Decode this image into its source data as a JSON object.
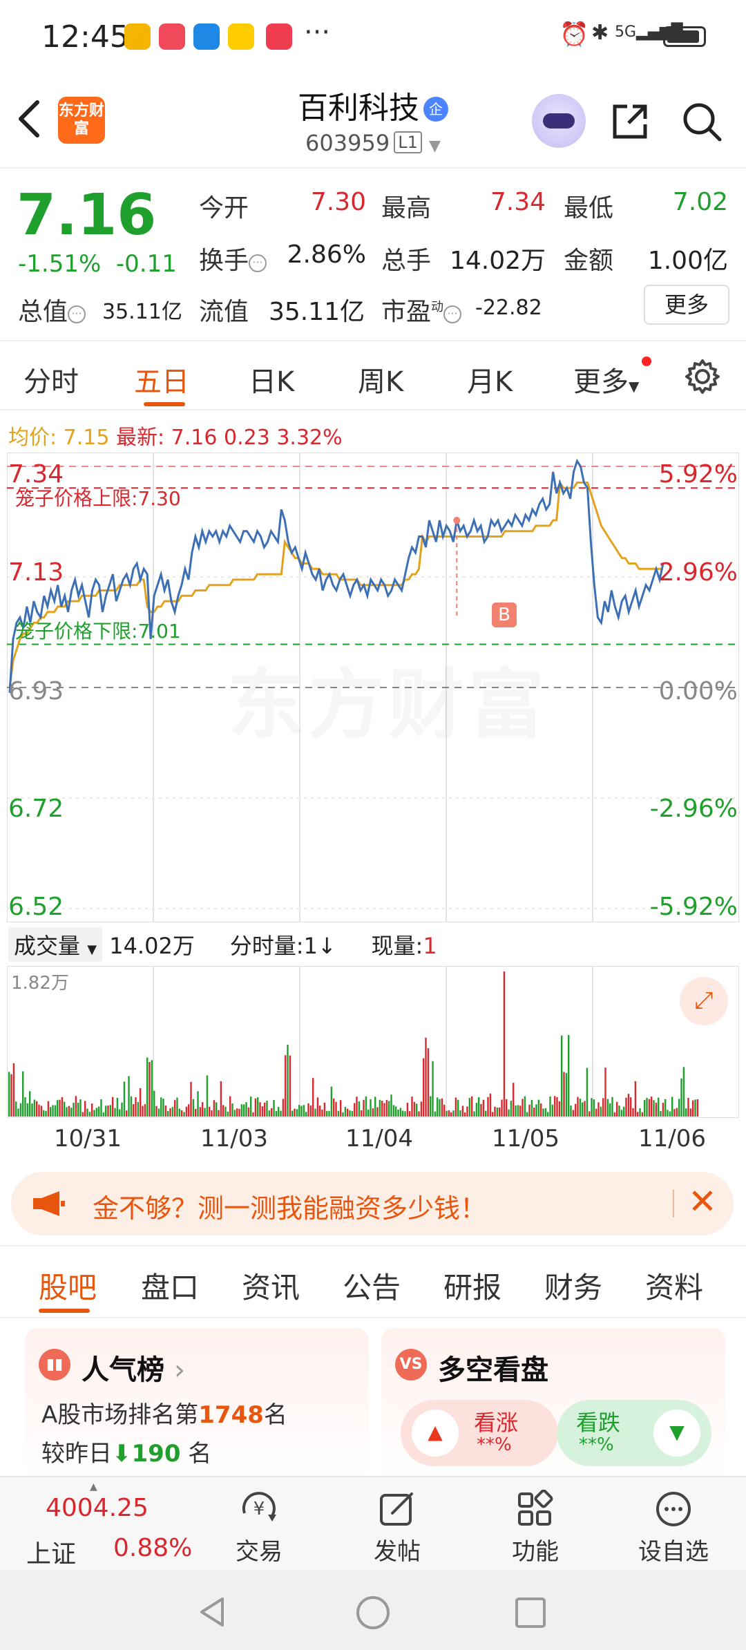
{
  "status_bar": {
    "time": "12:45",
    "more": "···",
    "icons": [
      "bluetooth-icon",
      "alarm-icon",
      "signal-icon",
      "battery-icon"
    ],
    "net": "5G"
  },
  "header": {
    "brand_logo_text": "东方财富",
    "stock_name": "百利科技",
    "badge": "企",
    "stock_code": "603959",
    "level": "L1"
  },
  "quote": {
    "price": "7.16",
    "change_pct": "-1.51%",
    "change_abs": "-0.11",
    "open_label": "今开",
    "open": "7.30",
    "high_label": "最高",
    "high": "7.34",
    "low_label": "最低",
    "low": "7.02",
    "turnover_label": "换手",
    "turnover": "2.86%",
    "volume_label": "总手",
    "volume": "14.02万",
    "amount_label": "金额",
    "amount": "1.00亿",
    "mktcap_label": "总值",
    "mktcap": "35.11亿",
    "float_label": "流值",
    "float_cap": "35.11亿",
    "pe_label": "市盈",
    "pe_sup": "动",
    "pe": "-22.82",
    "more_button": "更多"
  },
  "period_tabs": [
    "分时",
    "五日",
    "日K",
    "周K",
    "月K",
    "更多"
  ],
  "active_period": "五日",
  "legend": {
    "avg_label": "均价:",
    "avg_value": "7.15",
    "last_label": "最新:",
    "last_value": "7.16",
    "last_change": "0.23",
    "last_pct": "3.32%"
  },
  "chart_data": {
    "type": "line",
    "y_left_ticks": [
      "7.34",
      "7.13",
      "6.93",
      "6.72",
      "6.52"
    ],
    "y_right_ticks": [
      "5.92%",
      "2.96%",
      "0.00%",
      "-2.96%",
      "-5.92%"
    ],
    "ylim": [
      6.52,
      7.34
    ],
    "upper_limit_label": "笼子价格上限:",
    "upper_limit": 7.3,
    "upper_limit_text": "7.30",
    "lower_limit_label": "笼子价格下限:",
    "lower_limit": 7.01,
    "lower_limit_text": "7.01",
    "marker_label": "B",
    "dates": [
      "10/31",
      "11/03",
      "11/04",
      "11/05",
      "11/06"
    ],
    "series": [
      {
        "name": "price",
        "values": [
          6.92,
          7.02,
          7.05,
          7.06,
          7.04,
          7.08,
          7.05,
          7.09,
          7.07,
          7.06,
          7.1,
          7.08,
          7.11,
          7.09,
          7.12,
          7.08,
          7.1,
          7.07,
          7.11,
          7.13,
          7.1,
          7.12,
          7.09,
          7.06,
          7.11,
          7.13,
          7.12,
          7.07,
          7.1,
          7.12,
          7.14,
          7.09,
          7.11,
          7.13,
          7.14,
          7.12,
          7.15,
          7.16,
          7.13,
          7.15,
          7.14,
          7.02,
          7.1,
          7.12,
          7.14,
          7.11,
          7.13,
          7.09,
          7.07,
          7.1,
          7.12,
          7.15,
          7.13,
          7.18,
          7.21,
          7.19,
          7.22,
          7.2,
          7.22,
          7.21,
          7.22,
          7.2,
          7.22,
          7.21,
          7.23,
          7.22,
          7.21,
          7.2,
          7.22,
          7.22,
          7.21,
          7.2,
          7.22,
          7.21,
          7.19,
          7.2,
          7.22,
          7.21,
          7.2,
          7.26,
          7.24,
          7.2,
          7.18,
          7.19,
          7.17,
          7.15,
          7.18,
          7.16,
          7.14,
          7.13,
          7.15,
          7.11,
          7.13,
          7.14,
          7.12,
          7.11,
          7.13,
          7.14,
          7.12,
          7.1,
          7.12,
          7.13,
          7.11,
          7.12,
          7.1,
          7.13,
          7.12,
          7.11,
          7.13,
          7.12,
          7.1,
          7.11,
          7.13,
          7.12,
          7.11,
          7.14,
          7.17,
          7.19,
          7.18,
          7.21,
          7.21,
          7.19,
          7.24,
          7.22,
          7.2,
          7.24,
          7.21,
          7.23,
          7.22,
          7.2,
          7.24,
          7.22,
          7.23,
          7.21,
          7.22,
          7.24,
          7.22,
          7.23,
          7.2,
          7.21,
          7.24,
          7.23,
          7.24,
          7.22,
          7.23,
          7.24,
          7.23,
          7.25,
          7.24,
          7.23,
          7.25,
          7.24,
          7.26,
          7.25,
          7.27,
          7.28,
          7.26,
          7.27,
          7.33,
          7.29,
          7.31,
          7.29,
          7.3,
          7.28,
          7.33,
          7.35,
          7.34,
          7.31,
          7.3,
          7.2,
          7.12,
          7.06,
          7.05,
          7.09,
          7.07,
          7.11,
          7.08,
          7.06,
          7.09,
          7.1,
          7.07,
          7.09,
          7.11,
          7.08,
          7.1,
          7.12,
          7.11,
          7.13,
          7.15,
          7.13,
          7.16
        ]
      },
      {
        "name": "avg",
        "values": [
          6.93,
          6.98,
          7.0,
          7.02,
          7.03,
          7.03,
          7.04,
          7.05,
          7.05,
          7.06,
          7.06,
          7.07,
          7.07,
          7.07,
          7.08,
          7.08,
          7.08,
          7.09,
          7.09,
          7.09,
          7.09,
          7.1,
          7.1,
          7.1,
          7.1,
          7.1,
          7.11,
          7.11,
          7.11,
          7.11,
          7.11,
          7.11,
          7.12,
          7.12,
          7.12,
          7.12,
          7.12,
          7.12,
          7.13,
          7.13,
          7.08,
          7.07,
          7.07,
          7.08,
          7.08,
          7.09,
          7.09,
          7.09,
          7.09,
          7.09,
          7.1,
          7.1,
          7.1,
          7.1,
          7.11,
          7.11,
          7.11,
          7.11,
          7.12,
          7.12,
          7.12,
          7.12,
          7.12,
          7.12,
          7.12,
          7.13,
          7.13,
          7.13,
          7.13,
          7.13,
          7.13,
          7.13,
          7.14,
          7.14,
          7.14,
          7.14,
          7.14,
          7.14,
          7.14,
          7.14,
          7.2,
          7.19,
          7.18,
          7.17,
          7.17,
          7.16,
          7.16,
          7.16,
          7.15,
          7.15,
          7.15,
          7.14,
          7.14,
          7.14,
          7.14,
          7.14,
          7.13,
          7.13,
          7.13,
          7.13,
          7.13,
          7.13,
          7.12,
          7.12,
          7.12,
          7.12,
          7.12,
          7.12,
          7.12,
          7.12,
          7.12,
          7.12,
          7.12,
          7.12,
          7.12,
          7.13,
          7.13,
          7.14,
          7.14,
          7.15,
          7.21,
          7.2,
          7.21,
          7.21,
          7.21,
          7.21,
          7.21,
          7.21,
          7.21,
          7.21,
          7.21,
          7.21,
          7.21,
          7.21,
          7.21,
          7.21,
          7.21,
          7.21,
          7.21,
          7.21,
          7.21,
          7.21,
          7.21,
          7.21,
          7.22,
          7.22,
          7.22,
          7.22,
          7.22,
          7.22,
          7.22,
          7.22,
          7.22,
          7.23,
          7.23,
          7.23,
          7.23,
          7.23,
          7.24,
          7.24,
          7.31,
          7.3,
          7.3,
          7.3,
          7.3,
          7.31,
          7.31,
          7.31,
          7.31,
          7.29,
          7.27,
          7.25,
          7.23,
          7.22,
          7.21,
          7.2,
          7.19,
          7.18,
          7.17,
          7.17,
          7.16,
          7.16,
          7.16,
          7.15,
          7.15,
          7.15,
          7.15,
          7.15,
          7.15,
          7.15,
          7.15
        ]
      }
    ]
  },
  "volume": {
    "selector": "成交量",
    "total": "14.02万",
    "intraday_label": "分时量:",
    "intraday_value": "1",
    "intraday_arrow": "↓",
    "current_label": "现量:",
    "current_value": "1",
    "max_label": "1.82万"
  },
  "promo": {
    "text": "金不够？测一测我能融资多少钱！"
  },
  "bottom_tabs": [
    "股吧",
    "盘口",
    "资讯",
    "公告",
    "研报",
    "财务",
    "资料"
  ],
  "active_bottom_tab": "股吧",
  "popularity": {
    "title": "人气榜",
    "rank_prefix": "A股市场排名第",
    "rank": "1748",
    "rank_suffix": "名",
    "change_prefix": "较昨日",
    "change": "190",
    "change_suffix": "名"
  },
  "sentiment": {
    "title": "多空看盘",
    "bull_label": "看涨",
    "bull_value": "**%",
    "bear_label": "看跌",
    "bear_value": "**%"
  },
  "bottom_nav": {
    "index_value": "4004.25",
    "index_name": "上证",
    "index_pct": "0.88%",
    "items": [
      "交易",
      "发帖",
      "功能",
      "设自选"
    ]
  },
  "colors": {
    "up": "#d8282e",
    "down": "#1f9f2c",
    "accent": "#e8560e",
    "avg_line": "#e3a11c",
    "price_line": "#3d6fb5"
  }
}
